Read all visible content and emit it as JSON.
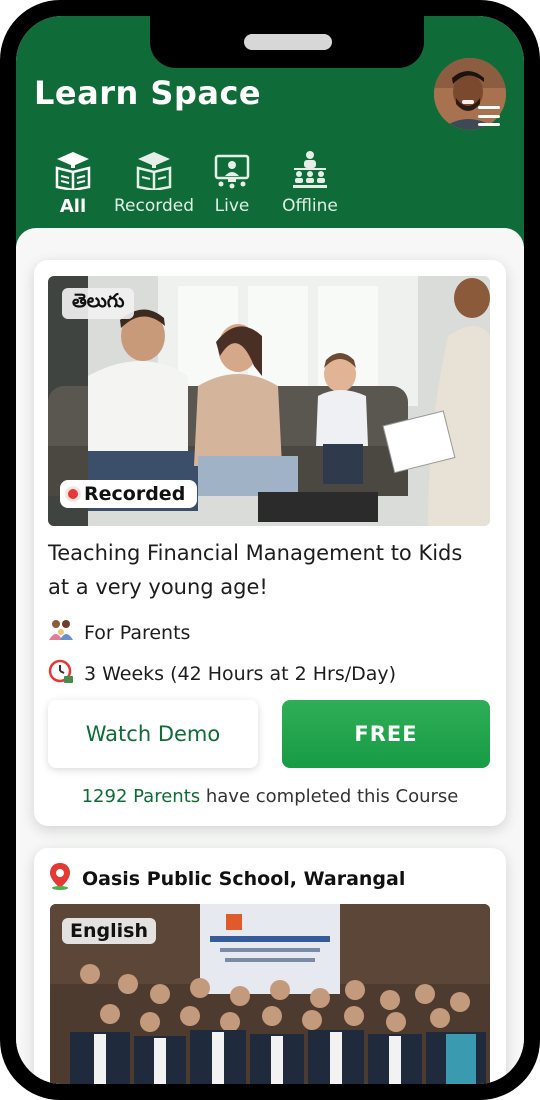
{
  "app": {
    "title": "Learn Space"
  },
  "tabs": [
    {
      "label": "All",
      "icon": "books-icon",
      "active": true
    },
    {
      "label": "Recorded",
      "icon": "recorded-book-icon",
      "active": false
    },
    {
      "label": "Live",
      "icon": "live-monitor-icon",
      "active": false
    },
    {
      "label": "Offline",
      "icon": "classroom-icon",
      "active": false
    }
  ],
  "courses": [
    {
      "language": "తెలుగు",
      "type_badge": "Recorded",
      "title": "Teaching Financial Management to Kids at a very young age!",
      "audience": "For Parents",
      "duration": "3 Weeks (42 Hours at 2 Hrs/Day)",
      "demo_label": "Watch Demo",
      "price_label": "FREE",
      "completed_count": "1292 Parents",
      "completed_text": "have completed this Course"
    },
    {
      "location": "Oasis Public School, Warangal",
      "language": "English"
    }
  ],
  "colors": {
    "header": "#0f6b37",
    "accent_green": "#1fa34c",
    "record_red": "#e53935"
  }
}
